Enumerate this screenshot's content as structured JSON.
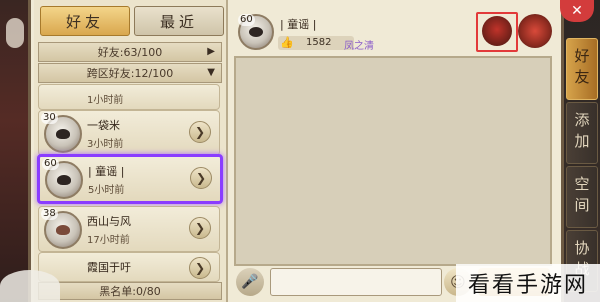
{
  "tabs": {
    "friends": "好友",
    "recent": "最近"
  },
  "groups": {
    "friends": "好友:63/100",
    "cross_server": "跨区好友:12/100"
  },
  "friends": [
    {
      "level": "",
      "name": "",
      "time": "1小时前"
    },
    {
      "level": "30",
      "name": "一袋米",
      "time": "3小时前"
    },
    {
      "level": "60",
      "name": "| 童谣 |",
      "time": "5小时前"
    },
    {
      "level": "38",
      "name": "西山与风",
      "time": "17小时前"
    },
    {
      "level": "",
      "name": "霞国于吁",
      "time": ""
    }
  ],
  "blacklist": "黑名单:0/80",
  "chat": {
    "level": "60",
    "name": "| 童谣 |",
    "likes": "1582",
    "guild": "凤之清"
  },
  "side_tabs": [
    "好友",
    "添加",
    "空间",
    "协战"
  ],
  "watermark": "看看手游网",
  "colors": {
    "accent": "#d9a74e",
    "selection": "#8a3cff",
    "close": "#d33c3c"
  }
}
